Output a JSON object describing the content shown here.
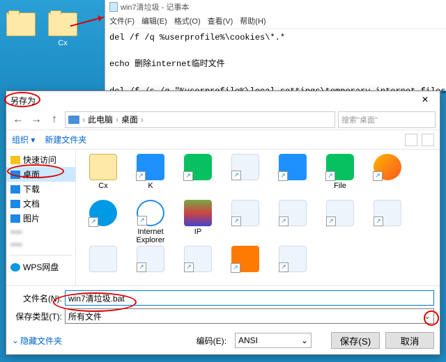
{
  "desktop": {
    "icons": [
      {
        "label": ""
      },
      {
        "label": "Cx"
      }
    ]
  },
  "notepad": {
    "title": "win7清垃圾 - 记事本",
    "menu": [
      "文件(F)",
      "编辑(E)",
      "格式(O)",
      "查看(V)",
      "帮助(H)"
    ],
    "content": "del /f /q %userprofile%\\cookies\\*.*\n\necho 删除internet临时文件\n\ndel /f /s /q \"%userprofile%\\local settings\\temporary internet files\\*.*\"\n\necho 删除当前用户日常操作临时文件"
  },
  "dialog": {
    "title": "另存为",
    "close": "✕",
    "nav": {
      "back": "←",
      "forward": "→",
      "up": "↑"
    },
    "breadcrumb": {
      "root": "此电脑",
      "sep": "›",
      "folder": "桌面",
      "chev": "›"
    },
    "search_placeholder": "搜索\"桌面\"",
    "toolbar": {
      "organize": "组织 ▾",
      "new_folder": "新建文件夹"
    },
    "sidebar": {
      "quick": "快速访问",
      "items": [
        {
          "label": "桌面",
          "icon": "#1e88e5",
          "sel": true
        },
        {
          "label": "下载",
          "icon": "#1e88e5"
        },
        {
          "label": "文档",
          "icon": "#1e88e5"
        },
        {
          "label": "图片",
          "icon": "#1e88e5"
        }
      ],
      "wps": "WPS网盘"
    },
    "files": [
      {
        "label": "Cx",
        "ico": "ico-folder"
      },
      {
        "label": "K",
        "ico": "ico-blue",
        "shortcut": true
      },
      {
        "label": "",
        "ico": "ico-green",
        "shortcut": true
      },
      {
        "label": "",
        "ico": "ico-generic",
        "shortcut": true,
        "blur": true
      },
      {
        "label": "",
        "ico": "ico-blue",
        "shortcut": true,
        "blur": true
      },
      {
        "label": "File",
        "ico": "ico-green",
        "shortcut": true
      },
      {
        "label": "",
        "ico": "ico-fox",
        "shortcut": true
      },
      {
        "label": "",
        "ico": "ico-round-blue",
        "shortcut": true,
        "blur": true
      },
      {
        "label": "Internet Explorer",
        "ico": "ico-ie",
        "shortcut": true
      },
      {
        "label": "IP",
        "ico": "ico-rar"
      },
      {
        "label": "",
        "ico": "ico-generic",
        "shortcut": true,
        "blur": true
      },
      {
        "label": "",
        "ico": "ico-generic",
        "shortcut": true,
        "blur": true
      },
      {
        "label": "",
        "ico": "ico-generic",
        "shortcut": true,
        "blur": true
      },
      {
        "label": "",
        "ico": "ico-generic",
        "shortcut": true,
        "blur": true
      },
      {
        "label": "",
        "ico": "ico-generic",
        "blur": true
      },
      {
        "label": "",
        "ico": "ico-generic",
        "shortcut": true,
        "blur": true
      },
      {
        "label": "",
        "ico": "ico-generic",
        "shortcut": true,
        "blur": true
      },
      {
        "label": "",
        "ico": "ico-orange",
        "shortcut": true
      },
      {
        "label": "",
        "ico": "ico-generic",
        "shortcut": true,
        "blur": true
      }
    ],
    "filename_label": "文件名(N):",
    "filename_value": "win7清垃圾.bat",
    "filetype_label": "保存类型(T):",
    "filetype_value": "所有文件",
    "hide_folders": "隐藏文件夹",
    "encoding_label": "编码(E):",
    "encoding_value": "ANSI",
    "save_btn": "保存(S)",
    "cancel_btn": "取消"
  }
}
